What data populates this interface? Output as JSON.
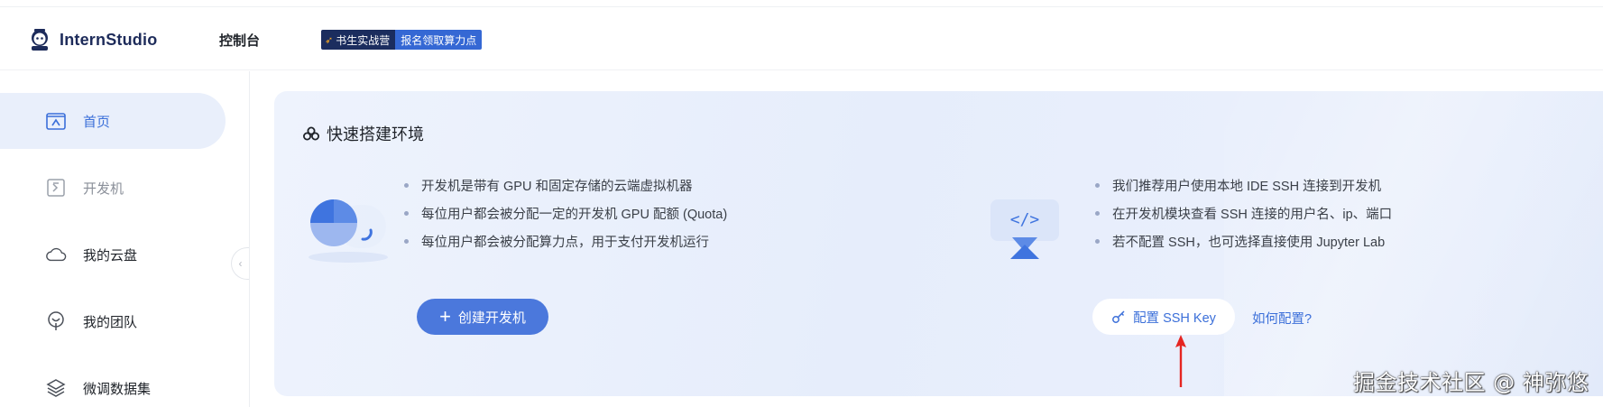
{
  "header": {
    "logo_text": "InternStudio",
    "console_label": "控制台",
    "camp_banner": {
      "left_label": "书生实战营",
      "right_label": "报名领取算力点"
    }
  },
  "sidebar": {
    "items": [
      {
        "label": "首页",
        "icon": "home-icon",
        "active": true
      },
      {
        "label": "开发机",
        "icon": "terminal-icon",
        "active": false
      },
      {
        "label": "我的云盘",
        "icon": "cloud-icon",
        "active": false
      },
      {
        "label": "我的团队",
        "icon": "team-icon",
        "active": false
      },
      {
        "label": "微调数据集",
        "icon": "dataset-icon",
        "active": false
      }
    ]
  },
  "main": {
    "card_title": "快速搭建环境",
    "left_section": {
      "bullets": [
        "开发机是带有 GPU 和固定存储的云端虚拟机器",
        "每位用户都会被分配一定的开发机 GPU 配额 (Quota)",
        "每位用户都会被分配算力点，用于支付开发机运行"
      ],
      "button_label": "创建开发机"
    },
    "right_section": {
      "bullets": [
        "我们推荐用户使用本地 IDE SSH 连接到开发机",
        "在开发机模块查看 SSH 连接的用户名、ip、端口",
        "若不配置 SSH，也可选择直接使用 Jupyter Lab"
      ],
      "button_label": "配置 SSH Key",
      "link_label": "如何配置?"
    }
  },
  "watermark": "掘金技术社区 @ 神弥悠",
  "colors": {
    "accent": "#3b6fd9",
    "primary_button": "#4b78dc",
    "annotation_arrow": "#e52521"
  }
}
